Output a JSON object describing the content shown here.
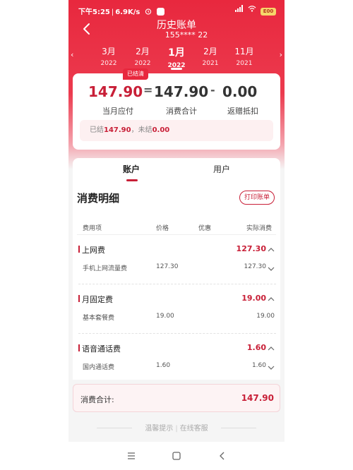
{
  "status_bar": {
    "time": "下午5:25",
    "speed": "6.9K/s",
    "battery": "E00"
  },
  "header": {
    "title": "历史账单",
    "phone": "155****  22"
  },
  "months": [
    {
      "month": "3月",
      "year": "2022",
      "active": false
    },
    {
      "month": "2月",
      "year": "2022",
      "active": false
    },
    {
      "month": "1月",
      "year": "2022",
      "active": true
    },
    {
      "month": "2月",
      "year": "2021",
      "active": false
    },
    {
      "month": "11月",
      "year": "2021",
      "active": false
    }
  ],
  "summary": {
    "badge": "已结清",
    "due_amount": "147.90",
    "equals": "=",
    "total_amount": "147.90",
    "minus": "-",
    "rebate_amount": "0.00",
    "due_label": "当月应付",
    "total_label": "消费合计",
    "rebate_label": "返赠抵扣",
    "settled_prefix": "已结",
    "settled_value": "147.90",
    "unsettled_prefix": "，未结",
    "unsettled_value": "0.00"
  },
  "tabs": [
    {
      "label": "账户",
      "active": true
    },
    {
      "label": "用户",
      "active": false
    }
  ],
  "detail": {
    "title": "消费明细",
    "print_button": "打印账单",
    "columns": [
      "费用项",
      "价格",
      "优惠",
      "实际消费"
    ],
    "categories": [
      {
        "name": "上网费",
        "amount": "127.30",
        "item": {
          "name": "手机上网流量费",
          "price": "127.30",
          "amount": "127.30",
          "has_arrow": true
        }
      },
      {
        "name": "月固定费",
        "amount": "19.00",
        "item": {
          "name": "基本套餐费",
          "price": "19.00",
          "amount": "19.00",
          "has_arrow": false
        }
      },
      {
        "name": "语音通话费",
        "amount": "1.60",
        "item": {
          "name": "国内通话费",
          "price": "1.60",
          "amount": "1.60",
          "has_arrow": true
        }
      }
    ]
  },
  "total": {
    "label": "消费合计:",
    "value": "147.90"
  },
  "footer": {
    "tips": "温馨提示",
    "separator": "|",
    "service": "在线客服"
  },
  "colors": {
    "brand_red": "#e8283e",
    "accent_red": "#c81f37"
  }
}
